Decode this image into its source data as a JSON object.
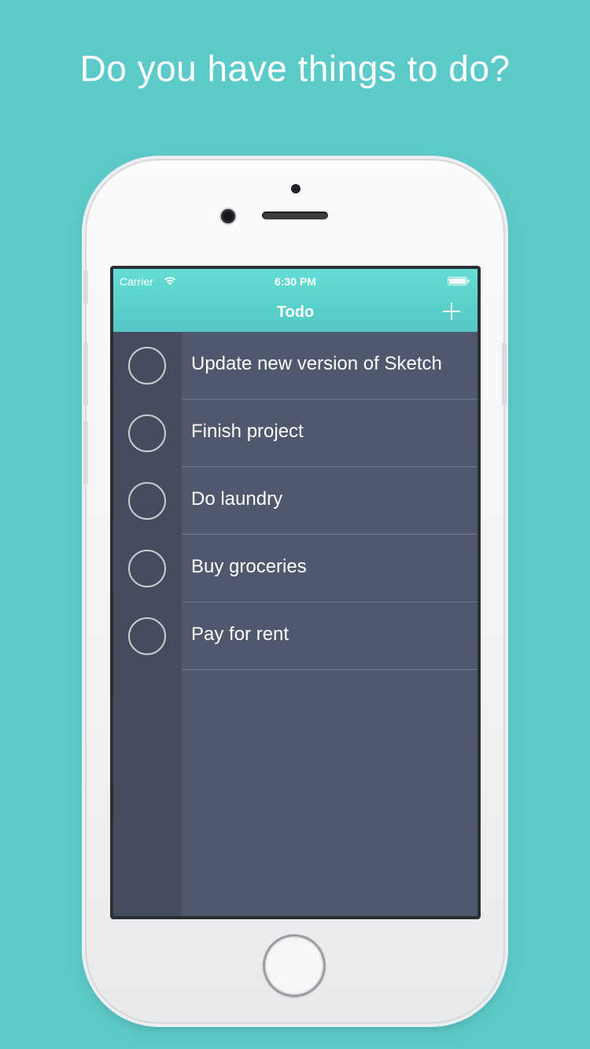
{
  "headline": "Do you have things to do?",
  "status_bar": {
    "carrier": "Carrier",
    "time": "6:30 PM",
    "wifi_icon": "wifi-icon",
    "battery_icon": "battery-icon"
  },
  "nav": {
    "title": "Todo",
    "add_icon": "plus-icon"
  },
  "todos": [
    {
      "label": "Update new version of Sketch",
      "done": false
    },
    {
      "label": "Finish project",
      "done": false
    },
    {
      "label": "Do laundry",
      "done": false
    },
    {
      "label": "Buy groceries",
      "done": false
    },
    {
      "label": "Pay for rent",
      "done": false
    }
  ],
  "colors": {
    "background": "#5dcaca",
    "nav_gradient_top": "#63ded4",
    "nav_gradient_bottom": "#54c7c6",
    "list_bg": "#4f586c",
    "gutter_bg": "#454c5e"
  }
}
